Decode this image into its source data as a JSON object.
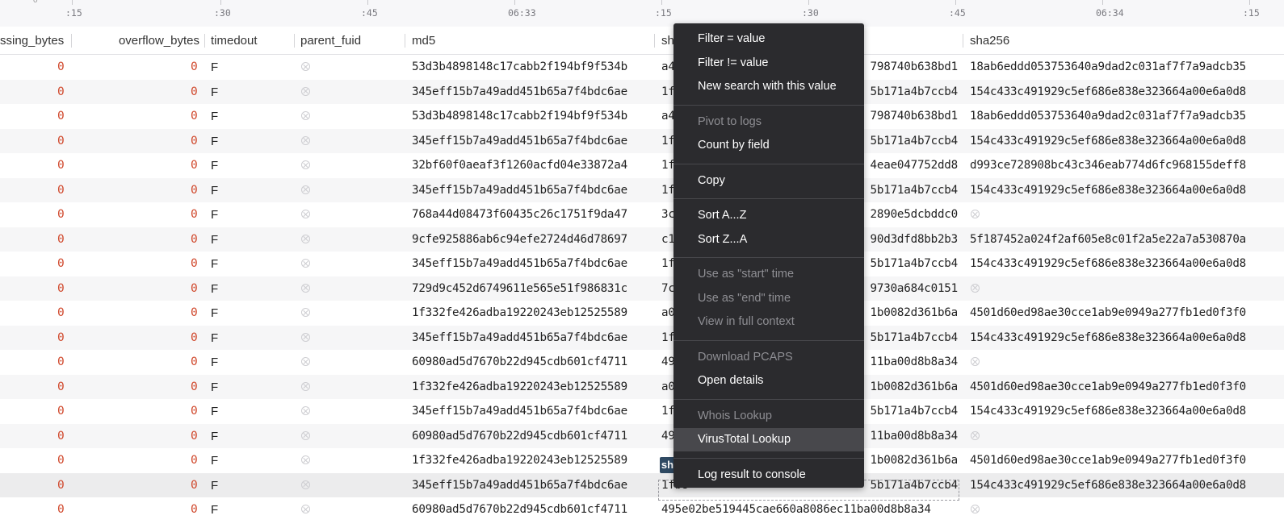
{
  "timeline": {
    "zero_label": "0",
    "ticks": [
      ":15",
      ":30",
      ":45",
      "06:33",
      ":15",
      ":30",
      ":45",
      "06:34",
      ":15"
    ]
  },
  "columns": {
    "missing_bytes": "ssing_bytes",
    "overflow_bytes": "overflow_bytes",
    "timedout": "timedout",
    "parent_fuid": "parent_fuid",
    "md5": "md5",
    "sha1": "sh",
    "sha256": "sha256"
  },
  "rows": [
    {
      "missing_bytes": "0",
      "overflow_bytes": "0",
      "timedout": "F",
      "md5": "53d3b4898148c17cabb2f194bf9f534b",
      "sha1_left": "a4",
      "sha1_right": "798740b638bd1",
      "sha256": "18ab6eddd053753640a9dad2c031af7f7a9adcb35"
    },
    {
      "missing_bytes": "0",
      "overflow_bytes": "0",
      "timedout": "F",
      "md5": "345eff15b7a49add451b65a7f4bdc6ae",
      "sha1_left": "1f",
      "sha1_right": "5b171a4b7ccb4",
      "sha256": "154c433c491929c5ef686e838e323664a00e6a0d8"
    },
    {
      "missing_bytes": "0",
      "overflow_bytes": "0",
      "timedout": "F",
      "md5": "53d3b4898148c17cabb2f194bf9f534b",
      "sha1_left": "a4",
      "sha1_right": "798740b638bd1",
      "sha256": "18ab6eddd053753640a9dad2c031af7f7a9adcb35"
    },
    {
      "missing_bytes": "0",
      "overflow_bytes": "0",
      "timedout": "F",
      "md5": "345eff15b7a49add451b65a7f4bdc6ae",
      "sha1_left": "1f",
      "sha1_right": "5b171a4b7ccb4",
      "sha256": "154c433c491929c5ef686e838e323664a00e6a0d8"
    },
    {
      "missing_bytes": "0",
      "overflow_bytes": "0",
      "timedout": "F",
      "md5": "32bf60f0aeaf3f1260acfd04e33872a4",
      "sha1_left": "1f",
      "sha1_right": "4eae047752dd8",
      "sha256": "d993ce728908bc43c346eab774d6fc968155deff8"
    },
    {
      "missing_bytes": "0",
      "overflow_bytes": "0",
      "timedout": "F",
      "md5": "345eff15b7a49add451b65a7f4bdc6ae",
      "sha1_left": "1f",
      "sha1_right": "5b171a4b7ccb4",
      "sha256": "154c433c491929c5ef686e838e323664a00e6a0d8"
    },
    {
      "missing_bytes": "0",
      "overflow_bytes": "0",
      "timedout": "F",
      "md5": "768a44d08473f60435c26c1751f9da47",
      "sha1_left": "3c",
      "sha1_right": "2890e5dcbddc0",
      "sha256": ""
    },
    {
      "missing_bytes": "0",
      "overflow_bytes": "0",
      "timedout": "F",
      "md5": "9cfe925886ab6c94efe2724d46d78697",
      "sha1_left": "c1",
      "sha1_right": "90d3dfd8bb2b3",
      "sha256": "5f187452a024f2af605e8c01f2a5e22a7a530870a"
    },
    {
      "missing_bytes": "0",
      "overflow_bytes": "0",
      "timedout": "F",
      "md5": "345eff15b7a49add451b65a7f4bdc6ae",
      "sha1_left": "1f",
      "sha1_right": "5b171a4b7ccb4",
      "sha256": "154c433c491929c5ef686e838e323664a00e6a0d8"
    },
    {
      "missing_bytes": "0",
      "overflow_bytes": "0",
      "timedout": "F",
      "md5": "729d9c452d6749611e565e51f986831c",
      "sha1_left": "7c",
      "sha1_right": "9730a684c0151",
      "sha256": ""
    },
    {
      "missing_bytes": "0",
      "overflow_bytes": "0",
      "timedout": "F",
      "md5": "1f332fe426adba19220243eb12525589",
      "sha1_left": "a0",
      "sha1_right": "1b0082d361b6a",
      "sha256": "4501d60ed98ae30cce1ab9e0949a277fb1ed0f3f0"
    },
    {
      "missing_bytes": "0",
      "overflow_bytes": "0",
      "timedout": "F",
      "md5": "345eff15b7a49add451b65a7f4bdc6ae",
      "sha1_left": "1f",
      "sha1_right": "5b171a4b7ccb4",
      "sha256": "154c433c491929c5ef686e838e323664a00e6a0d8"
    },
    {
      "missing_bytes": "0",
      "overflow_bytes": "0",
      "timedout": "F",
      "md5": "60980ad5d7670b22d945cdb601cf4711",
      "sha1_left": "49",
      "sha1_right": "11ba00d8b8a34",
      "sha256": ""
    },
    {
      "missing_bytes": "0",
      "overflow_bytes": "0",
      "timedout": "F",
      "md5": "1f332fe426adba19220243eb12525589",
      "sha1_left": "a0",
      "sha1_right": "1b0082d361b6a",
      "sha256": "4501d60ed98ae30cce1ab9e0949a277fb1ed0f3f0"
    },
    {
      "missing_bytes": "0",
      "overflow_bytes": "0",
      "timedout": "F",
      "md5": "345eff15b7a49add451b65a7f4bdc6ae",
      "sha1_left": "1f",
      "sha1_right": "5b171a4b7ccb4",
      "sha256": "154c433c491929c5ef686e838e323664a00e6a0d8"
    },
    {
      "missing_bytes": "0",
      "overflow_bytes": "0",
      "timedout": "F",
      "md5": "60980ad5d7670b22d945cdb601cf4711",
      "sha1_left": "49",
      "sha1_right": "11ba00d8b8a34",
      "sha256": ""
    },
    {
      "missing_bytes": "0",
      "overflow_bytes": "0",
      "timedout": "F",
      "md5": "1f332fe426adba19220243eb12525589",
      "sha1_left": "",
      "sha1_right": "1b0082d361b6a",
      "sha256": "4501d60ed98ae30cce1ab9e0949a277fb1ed0f3f0"
    },
    {
      "missing_bytes": "0",
      "overflow_bytes": "0",
      "timedout": "F",
      "md5": "345eff15b7a49add451b65a7f4bdc6ae",
      "sha1_left": "1fb8",
      "sha1_right": "5b171a4b7ccb4",
      "sha256": "154c433c491929c5ef686e838e323664a00e6a0d8",
      "selected": true
    },
    {
      "missing_bytes": "0",
      "overflow_bytes": "0",
      "timedout": "F",
      "md5": "60980ad5d7670b22d945cdb601cf4711",
      "sha1_left": "495e02be519445cae660a8086ec11ba00d8b8a34",
      "sha1_right": "",
      "sha256": ""
    }
  ],
  "selected_badge": "sh",
  "context_menu": {
    "items": [
      {
        "label": "Filter = value",
        "disabled": false
      },
      {
        "label": "Filter != value",
        "disabled": false
      },
      {
        "label": "New search with this value",
        "disabled": false
      },
      {
        "sep": true
      },
      {
        "label": "Pivot to logs",
        "disabled": true
      },
      {
        "label": "Count by field",
        "disabled": false
      },
      {
        "sep": true
      },
      {
        "label": "Copy",
        "disabled": false
      },
      {
        "sep": true
      },
      {
        "label": "Sort A...Z",
        "disabled": false
      },
      {
        "label": "Sort Z...A",
        "disabled": false
      },
      {
        "sep": true
      },
      {
        "label": "Use as \"start\" time",
        "disabled": true
      },
      {
        "label": "Use as \"end\" time",
        "disabled": true
      },
      {
        "label": "View in full context",
        "disabled": true
      },
      {
        "sep": true
      },
      {
        "label": "Download PCAPS",
        "disabled": true
      },
      {
        "label": "Open details",
        "disabled": false
      },
      {
        "sep": true
      },
      {
        "label": "Whois Lookup",
        "disabled": true
      },
      {
        "label": "VirusTotal Lookup",
        "disabled": false,
        "highlighted": true
      },
      {
        "sep": true
      },
      {
        "label": "Log result to console",
        "disabled": false
      }
    ]
  },
  "colors": {
    "number": "#d0482c",
    "menu_bg": "#2b2b2e",
    "menu_highlight": "#48484c",
    "disabled_text": "#8e8e93"
  }
}
